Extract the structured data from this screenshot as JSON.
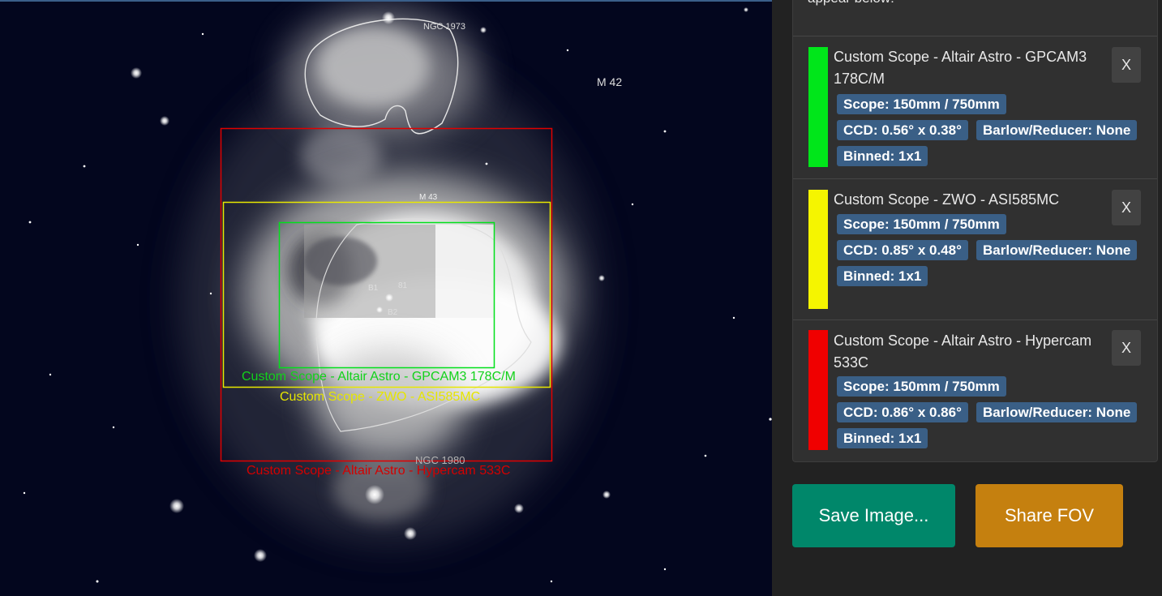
{
  "sky": {
    "labels": {
      "ngc1973": "NGC 1973",
      "m42": "M 42",
      "m43": "M 43",
      "ngc1980": "NGC 1980",
      "num_b1": "B1",
      "num_b2": "B2",
      "num_81": "81"
    },
    "fov_labels": {
      "green": "Custom Scope - Altair Astro - GPCAM3 178C/M",
      "yellow": "Custom Scope - ZWO - ASI585MC",
      "red": "Custom Scope - Altair Astro - Hypercam 533C"
    }
  },
  "panel": {
    "intro_text": "appear below:",
    "entries": [
      {
        "title": "Custom Scope - Altair Astro - GPCAM3 178C/M",
        "color": "#00e61a",
        "close": "X",
        "scope": "Scope: 150mm / 750mm",
        "ccd": "CCD: 0.56° x 0.38°",
        "barlow": "Barlow/Reducer: None",
        "binned": "Binned: 1x1"
      },
      {
        "title": "Custom Scope - ZWO - ASI585MC",
        "color": "#f5f500",
        "close": "X",
        "scope": "Scope: 150mm / 750mm",
        "ccd": "CCD: 0.85° x 0.48°",
        "barlow": "Barlow/Reducer: None",
        "binned": "Binned: 1x1"
      },
      {
        "title": "Custom Scope - Altair Astro - Hypercam 533C",
        "color": "#f00000",
        "close": "X",
        "scope": "Scope: 150mm / 750mm",
        "ccd": "CCD: 0.86° x 0.86°",
        "barlow": "Barlow/Reducer: None",
        "binned": "Binned: 1x1"
      }
    ],
    "buttons": {
      "save": "Save Image...",
      "share": "Share FOV"
    },
    "colors": {
      "save": "#00876a",
      "share": "#c5800f"
    }
  }
}
